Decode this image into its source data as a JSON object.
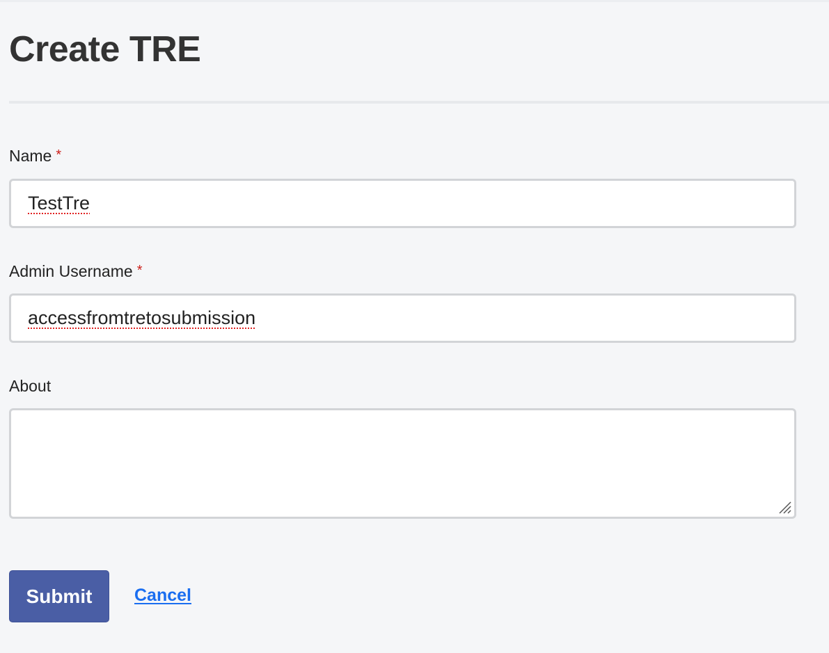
{
  "page": {
    "title": "Create TRE"
  },
  "form": {
    "required_marker": "*",
    "name": {
      "label": "Name",
      "value": "TestTre",
      "required": true
    },
    "admin_username": {
      "label": "Admin Username",
      "value": "accessfromtretosubmission",
      "required": true
    },
    "about": {
      "label": "About",
      "value": ""
    }
  },
  "actions": {
    "submit_label": "Submit",
    "cancel_label": "Cancel"
  },
  "colors": {
    "background": "#f5f6f8",
    "primary_button": "#4a5ea5",
    "link": "#1a6ef0",
    "required": "#cc1f1a"
  }
}
